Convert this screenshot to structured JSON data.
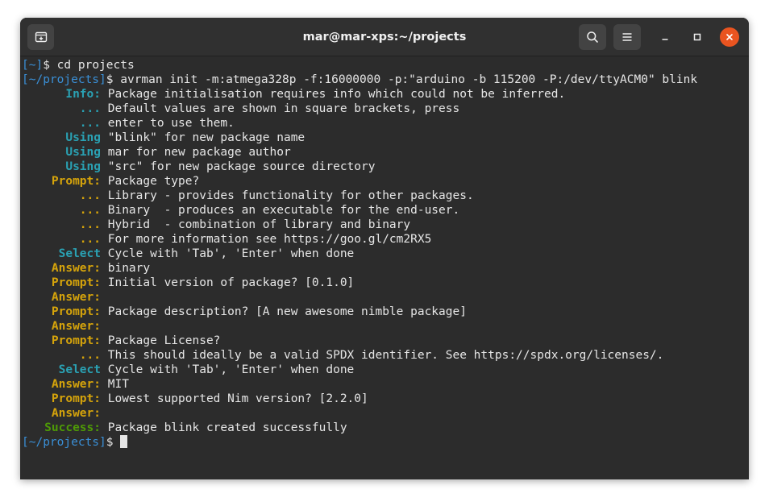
{
  "window": {
    "title": "mar@mar-xps:~/projects",
    "icons": {
      "new_tab": "new-tab-icon",
      "search": "search-icon",
      "menu": "hamburger-menu-icon",
      "minimize": "minimize-icon",
      "maximize": "maximize-icon",
      "close": "close-icon"
    },
    "close_color": "#e95420"
  },
  "terminal": {
    "prompt1": {
      "path": "[~]",
      "symbol": "$",
      "command": " cd projects"
    },
    "prompt2": {
      "path": "[~/projects]",
      "symbol": "$",
      "command": " avrman init -m:atmega328p -f:16000000 -p:\"arduino -b 115200 -P:/dev/ttyACM0\" blink"
    },
    "lines": [
      {
        "label": "Info:",
        "style": "info",
        "text": "Package initialisation requires info which could not be inferred."
      },
      {
        "label": "...",
        "style": "info",
        "text": "Default values are shown in square brackets, press"
      },
      {
        "label": "...",
        "style": "info",
        "text": "enter to use them."
      },
      {
        "label": "Using",
        "style": "using",
        "text": "\"blink\" for new package name"
      },
      {
        "label": "Using",
        "style": "using",
        "text": "mar for new package author"
      },
      {
        "label": "Using",
        "style": "using",
        "text": "\"src\" for new package source directory"
      },
      {
        "label": "Prompt:",
        "style": "prompt",
        "text": "Package type?"
      },
      {
        "label": "...",
        "style": "dots",
        "text": "Library - provides functionality for other packages."
      },
      {
        "label": "...",
        "style": "dots",
        "text": "Binary  - produces an executable for the end-user."
      },
      {
        "label": "...",
        "style": "dots",
        "text": "Hybrid  - combination of library and binary"
      },
      {
        "label": "...",
        "style": "dots",
        "text": "For more information see https://goo.gl/cm2RX5"
      },
      {
        "label": "Select",
        "style": "select",
        "text": "Cycle with 'Tab', 'Enter' when done"
      },
      {
        "label": "Answer:",
        "style": "answer",
        "text": "binary"
      },
      {
        "label": "Prompt:",
        "style": "prompt",
        "text": "Initial version of package? [0.1.0]"
      },
      {
        "label": "Answer:",
        "style": "answer",
        "text": ""
      },
      {
        "label": "Prompt:",
        "style": "prompt",
        "text": "Package description? [A new awesome nimble package]"
      },
      {
        "label": "Answer:",
        "style": "answer",
        "text": ""
      },
      {
        "label": "Prompt:",
        "style": "prompt",
        "text": "Package License?"
      },
      {
        "label": "...",
        "style": "dots",
        "text": "This should ideally be a valid SPDX identifier. See https://spdx.org/licenses/."
      },
      {
        "label": "Select",
        "style": "select",
        "text": "Cycle with 'Tab', 'Enter' when done"
      },
      {
        "label": "Answer:",
        "style": "answer",
        "text": "MIT"
      },
      {
        "label": "Prompt:",
        "style": "prompt",
        "text": "Lowest supported Nim version? [2.2.0]"
      },
      {
        "label": "Answer:",
        "style": "answer",
        "text": ""
      },
      {
        "label": "Success:",
        "style": "success",
        "text": "Package blink created successfully"
      }
    ],
    "prompt3": {
      "path": "[~/projects]",
      "symbol": "$",
      "command": " "
    },
    "colors": {
      "background": "#2c2c2c",
      "text": "#e6e6e6",
      "path": "#3a8fd6",
      "info": "#2aa1b3",
      "prompt": "#d6a40b",
      "success": "#4e9a06"
    }
  }
}
